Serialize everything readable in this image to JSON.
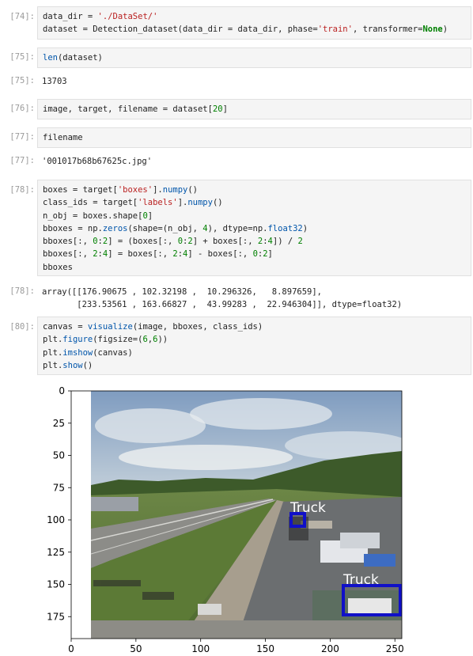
{
  "cells": [
    {
      "prompt": "[74]:",
      "type": "input",
      "lines": [
        "data_dir = './DataSet/'",
        "dataset = Detection_dataset(data_dir = data_dir, phase='train', transformer=None)"
      ]
    },
    {
      "prompt": "[75]:",
      "type": "input",
      "lines": [
        "len(dataset)"
      ]
    },
    {
      "prompt": "[75]:",
      "type": "output",
      "lines": [
        "13703"
      ]
    },
    {
      "prompt": "[76]:",
      "type": "input",
      "lines": [
        "image, target, filename = dataset[20]"
      ]
    },
    {
      "prompt": "[77]:",
      "type": "input",
      "lines": [
        "filename"
      ]
    },
    {
      "prompt": "[77]:",
      "type": "output",
      "lines": [
        "'001017b68b67625c.jpg'"
      ]
    },
    {
      "prompt": "[78]:",
      "type": "input",
      "lines": [
        "boxes = target['boxes'].numpy()",
        "class_ids = target['labels'].numpy()",
        "n_obj = boxes.shape[0]",
        "bboxes = np.zeros(shape=(n_obj, 4), dtype=np.float32)",
        "bboxes[:, 0:2] = (boxes[:, 0:2] + boxes[:, 2:4]) / 2",
        "bboxes[:, 2:4] = boxes[:, 2:4] - boxes[:, 0:2]",
        "bboxes"
      ]
    },
    {
      "prompt": "[78]:",
      "type": "output",
      "lines": [
        "array([[176.90675 , 102.32198 ,  10.296326,   8.897659],",
        "       [233.53561 , 163.66827 ,  43.99283 ,  22.946304]], dtype=float32)"
      ]
    },
    {
      "prompt": "[80]:",
      "type": "input",
      "lines": [
        "canvas = visualize(image, bboxes, class_ids)",
        "plt.figure(figsize=(6,6))",
        "plt.imshow(canvas)",
        "plt.show()"
      ]
    }
  ],
  "plot": {
    "y_ticks": [
      "0",
      "25",
      "50",
      "75",
      "100",
      "125",
      "150",
      "175"
    ],
    "x_ticks": [
      "0",
      "50",
      "100",
      "150",
      "200",
      "250"
    ],
    "detections": [
      {
        "label": "Truck",
        "color": "#1010c8"
      },
      {
        "label": "Truck",
        "color": "#1010c8"
      }
    ],
    "colors": {
      "sky_top": "#8aa4c4",
      "sky_mid": "#c9d4dc",
      "grass": "#5e7a3c",
      "track": "#8a8a86",
      "trees": "#3a5228",
      "box": "#1010c8"
    }
  }
}
